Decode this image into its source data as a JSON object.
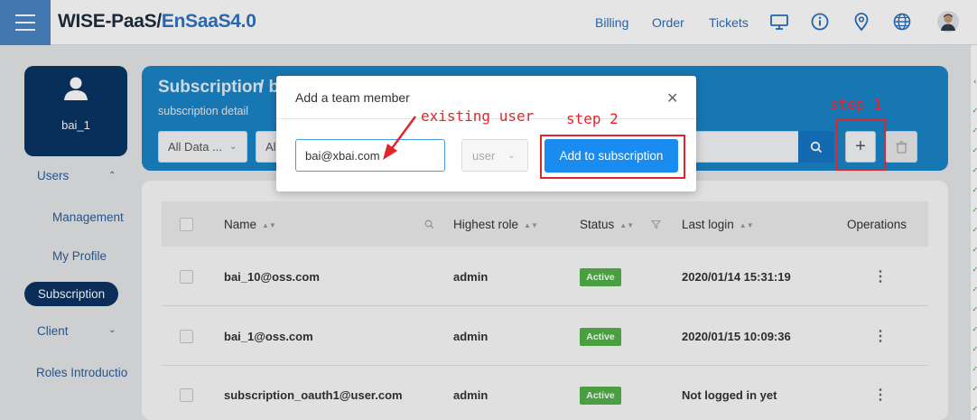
{
  "topbar": {
    "brand_part1": "WISE-PaaS/",
    "brand_part2": "EnSaaS4.0",
    "nav": [
      "Billing",
      "Order",
      "Tickets"
    ],
    "icons": [
      "monitor-icon",
      "info-icon",
      "location-icon",
      "globe-icon",
      "user-avatar-icon"
    ]
  },
  "sidebar": {
    "username": "bai_1",
    "items": [
      {
        "label": "Users"
      },
      {
        "label": "Management"
      },
      {
        "label": "My Profile"
      },
      {
        "label": "Subscription"
      },
      {
        "label": "Client"
      },
      {
        "label": "Roles Introductio"
      }
    ]
  },
  "header": {
    "title": "Subscription",
    "title_sep": "/ b",
    "subtitle": "subscription detail",
    "filters": [
      "All Data ...",
      "Al"
    ]
  },
  "table": {
    "columns": [
      "Name",
      "Highest role",
      "Status",
      "Last login",
      "Operations"
    ],
    "rows": [
      {
        "name": "bai_10@oss.com",
        "role": "admin",
        "status": "Active",
        "last_login": "2020/01/14 15:31:19"
      },
      {
        "name": "bai_1@oss.com",
        "role": "admin",
        "status": "Active",
        "last_login": "2020/01/15 10:09:36"
      },
      {
        "name": "subscription_oauth1@user.com",
        "role": "admin",
        "status": "Active",
        "last_login": "Not logged in yet"
      }
    ]
  },
  "modal": {
    "title": "Add a team member",
    "email_value": "bai@xbai.com",
    "role_value": "user",
    "add_label": "Add to subscription"
  },
  "annotations": {
    "step1": "step 1",
    "step2": "step 2",
    "existing_user": "existing user"
  },
  "colors": {
    "primary": "#1a85c8",
    "navy": "#0a3565",
    "active_badge": "#52b24a",
    "annotation_red": "#e0262b",
    "button_blue": "#1a8cf0"
  }
}
